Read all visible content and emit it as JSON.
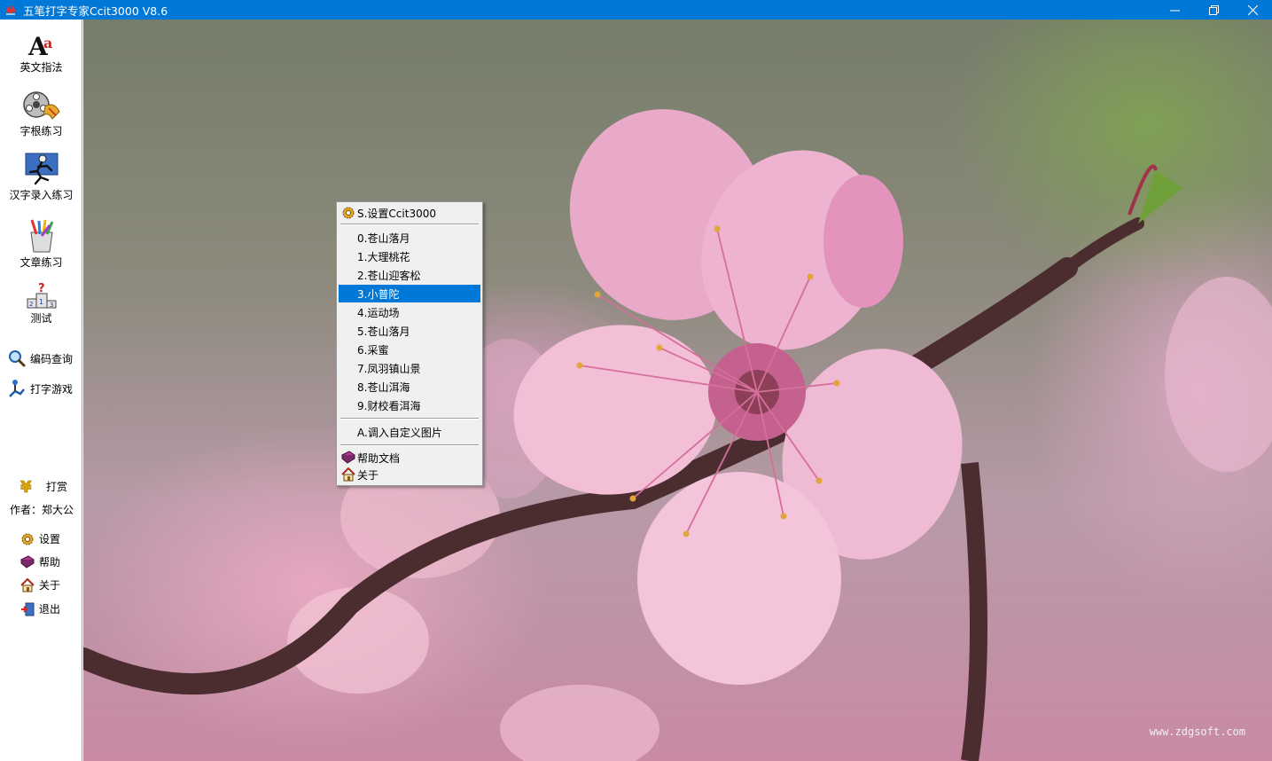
{
  "window": {
    "title": "五笔打字专家Ccit3000 V8.6",
    "accent": "#0078d7"
  },
  "sidebar": {
    "big_items": [
      {
        "label": "英文指法",
        "icon": "letters-aa-icon"
      },
      {
        "label": "字根练习",
        "icon": "film-reel-icon"
      },
      {
        "label": "汉字录入练习",
        "icon": "runner-icon"
      },
      {
        "label": "文章练习",
        "icon": "pencil-cup-icon"
      },
      {
        "label": "测试",
        "icon": "podium-icon"
      }
    ],
    "mid_items": [
      {
        "label": "编码查询",
        "icon": "magnifier-icon"
      },
      {
        "label": "打字游戏",
        "icon": "joystick-icon"
      }
    ],
    "reward": {
      "label": "打赏",
      "icon": "yen-icon"
    },
    "author": "作者：郑大公",
    "bottom_items": [
      {
        "label": "设置",
        "icon": "gear-icon"
      },
      {
        "label": "帮助",
        "icon": "book-icon"
      },
      {
        "label": "关于",
        "icon": "home-icon"
      },
      {
        "label": "退出",
        "icon": "exit-icon"
      }
    ]
  },
  "wallpaper": {
    "watermark": "www.zdgsoft.com"
  },
  "context_menu": {
    "settings": "S.设置Ccit3000",
    "backgrounds": [
      "0.苍山落月",
      "1.大理桃花",
      "2.苍山迎客松",
      "3.小普陀",
      "4.运动场",
      "5.苍山落月",
      "6.采蜜",
      "7.凤羽镇山景",
      "8.苍山洱海",
      "9.财校看洱海"
    ],
    "selected_index": 3,
    "custom_image": "A.调入自定义图片",
    "help_doc": "帮助文档",
    "about": "关于"
  }
}
